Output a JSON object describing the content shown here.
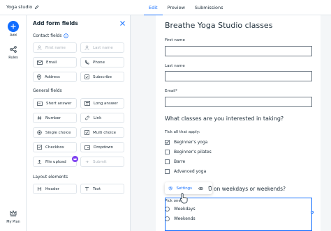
{
  "header": {
    "site_name": "Yoga studio",
    "tabs": [
      {
        "label": "Edit",
        "active": true
      },
      {
        "label": "Preview",
        "active": false
      },
      {
        "label": "Submissions",
        "active": false
      }
    ]
  },
  "rail": {
    "add_label": "Add",
    "rules_label": "Rules",
    "plan_label": "My Plan"
  },
  "panel": {
    "title": "Add form fields",
    "contact_label": "Contact fields",
    "contact_fields": [
      {
        "label": "First name",
        "icon": "person-icon",
        "disabled": true
      },
      {
        "label": "Last name",
        "icon": "person-icon",
        "disabled": true
      },
      {
        "label": "Email",
        "icon": "mail-icon",
        "disabled": false
      },
      {
        "label": "Phone",
        "icon": "phone-icon",
        "disabled": false
      },
      {
        "label": "Address",
        "icon": "location-icon",
        "disabled": false
      },
      {
        "label": "Subscribe",
        "icon": "subscribe-icon",
        "disabled": false
      }
    ],
    "general_label": "General fields",
    "general_fields": [
      {
        "label": "Short answer",
        "icon": "short-answer-icon",
        "disabled": false
      },
      {
        "label": "Long answer",
        "icon": "long-answer-icon",
        "disabled": false
      },
      {
        "label": "Number",
        "icon": "number-icon",
        "disabled": false
      },
      {
        "label": "Link",
        "icon": "link-icon",
        "disabled": false
      },
      {
        "label": "Single choice",
        "icon": "single-choice-icon",
        "disabled": false
      },
      {
        "label": "Multi choice",
        "icon": "multi-choice-icon",
        "disabled": false
      },
      {
        "label": "Checkbox",
        "icon": "checkbox-icon",
        "disabled": false
      },
      {
        "label": "Dropdown",
        "icon": "dropdown-icon",
        "disabled": false
      },
      {
        "label": "File upload",
        "icon": "file-upload-icon",
        "disabled": false
      },
      {
        "label": "Submit",
        "icon": "submit-icon",
        "disabled": true
      }
    ],
    "layout_label": "Layout elements",
    "layout_fields": [
      {
        "label": "Header",
        "icon": "header-icon",
        "disabled": false
      },
      {
        "label": "Text",
        "icon": "text-icon",
        "disabled": false
      }
    ]
  },
  "form": {
    "title": "Breathe Yoga Studio classes",
    "first_name_label": "First name",
    "last_name_label": "Last name",
    "email_label": "Email*",
    "classes_question": "What classes are you interested in taking?",
    "tick_label": "Tick all that apply:",
    "classes": [
      {
        "label": "Beginner's yoga",
        "checked": true
      },
      {
        "label": "Beginner's pilates",
        "checked": false
      },
      {
        "label": "Barre",
        "checked": false
      },
      {
        "label": "Advanced yoga",
        "checked": false
      }
    ],
    "days_question_partial": "on weekdays or weekends?",
    "pick_label": "Pick one:",
    "days_options": [
      "Weekdays",
      "Weekends"
    ],
    "toolbar_settings": "Settings"
  },
  "colors": {
    "accent": "#116dff",
    "badge": "#7a3bf0"
  }
}
